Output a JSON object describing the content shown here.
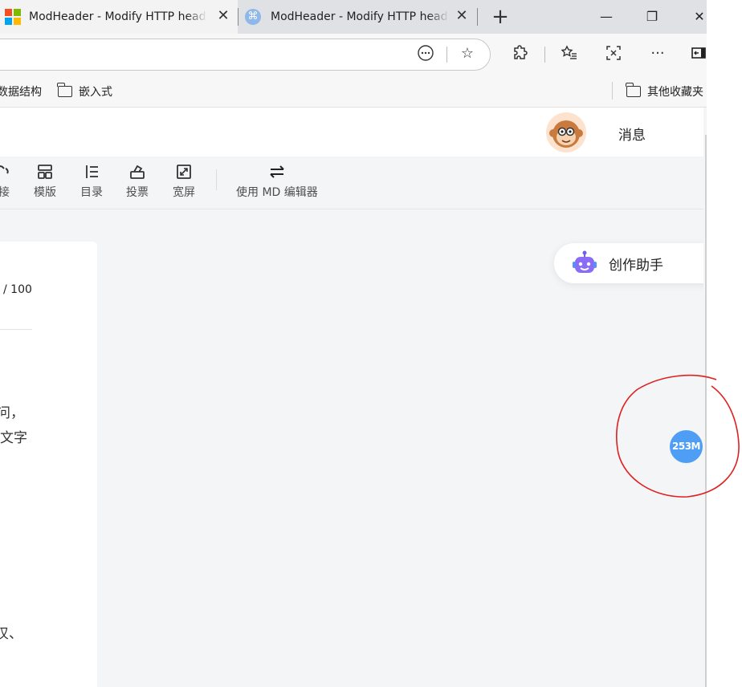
{
  "tabs": [
    {
      "title": "ModHeader - Modify HTTP headers",
      "favicon": "microsoft-logo-icon",
      "active": true
    },
    {
      "title": "ModHeader - Modify HTTP headers",
      "favicon": "extension-gear-icon",
      "active": false
    }
  ],
  "window_controls": {
    "minimize": "—",
    "restore": "❐",
    "close": "✕"
  },
  "bookmarks": [
    {
      "label": "数据结构"
    },
    {
      "label": "嵌入式"
    },
    {
      "label": "其他收藏夹"
    }
  ],
  "header": {
    "messages_label": "消息"
  },
  "toolbar": {
    "items": [
      {
        "label": "接",
        "icon": "link-icon"
      },
      {
        "label": "模版",
        "icon": "template-icon"
      },
      {
        "label": "目录",
        "icon": "toc-icon"
      },
      {
        "label": "投票",
        "icon": "vote-icon"
      },
      {
        "label": "宽屏",
        "icon": "widescreen-icon"
      },
      {
        "label": "使用 MD 编辑器",
        "icon": "swap-icon"
      }
    ]
  },
  "editor": {
    "title_counter": "/ 100",
    "fragments": [
      "问，",
      "文字",
      "叹、"
    ]
  },
  "assistant": {
    "label": "创作助手"
  },
  "memory_badge": {
    "text": "253M"
  },
  "colors": {
    "accent_blue": "#4f9ef5",
    "annotation_red": "#e02020",
    "avatar_bg": "#fde3cd"
  }
}
